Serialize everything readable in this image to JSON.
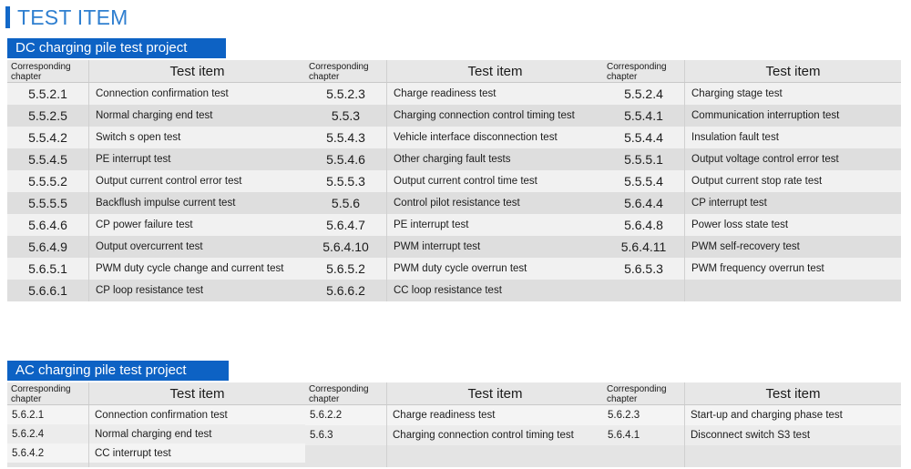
{
  "page": {
    "title": "TEST ITEM",
    "accent_color": "#1268c8",
    "title_color": "#2f7fd0",
    "banner_color": "#0d62c4"
  },
  "headers": {
    "chapter": "Corresponding chapter",
    "chapter_line1": "Corresponding",
    "chapter_line2": "chapter",
    "item": "Test item"
  },
  "dc_section": {
    "banner": "DC charging pile test project",
    "groups": [
      {
        "rows": [
          {
            "chapter": "5.5.2.1",
            "item": "Connection confirmation test"
          },
          {
            "chapter": "5.5.2.5",
            "item": "Normal charging end test"
          },
          {
            "chapter": "5.5.4.2",
            "item": "Switch s open test"
          },
          {
            "chapter": "5.5.4.5",
            "item": "PE interrupt test"
          },
          {
            "chapter": "5.5.5.2",
            "item": "Output current control error test"
          },
          {
            "chapter": "5.5.5.5",
            "item": "Backflush impulse current test"
          },
          {
            "chapter": "5.6.4.6",
            "item": "CP power failure test"
          },
          {
            "chapter": "5.6.4.9",
            "item": "Output overcurrent test"
          },
          {
            "chapter": "5.6.5.1",
            "item": "PWM duty cycle change and current test"
          },
          {
            "chapter": "5.6.6.1",
            "item": "CP loop resistance test"
          }
        ]
      },
      {
        "rows": [
          {
            "chapter": "5.5.2.3",
            "item": "Charge readiness test"
          },
          {
            "chapter": "5.5.3",
            "item": "Charging connection control timing test"
          },
          {
            "chapter": "5.5.4.3",
            "item": "Vehicle interface disconnection test"
          },
          {
            "chapter": "5.5.4.6",
            "item": "Other charging fault tests"
          },
          {
            "chapter": "5.5.5.3",
            "item": "Output current control time test"
          },
          {
            "chapter": "5.5.6",
            "item": "Control pilot resistance test"
          },
          {
            "chapter": "5.6.4.7",
            "item": "PE interrupt test"
          },
          {
            "chapter": "5.6.4.10",
            "item": "PWM interrupt test"
          },
          {
            "chapter": "5.6.5.2",
            "item": "PWM duty cycle overrun test"
          },
          {
            "chapter": "5.6.6.2",
            "item": "CC loop resistance test"
          }
        ]
      },
      {
        "rows": [
          {
            "chapter": "5.5.2.4",
            "item": "Charging stage test"
          },
          {
            "chapter": "5.5.4.1",
            "item": "Communication interruption test"
          },
          {
            "chapter": "5.5.4.4",
            "item": "Insulation fault test"
          },
          {
            "chapter": "5.5.5.1",
            "item": "Output voltage control error test"
          },
          {
            "chapter": "5.5.5.4",
            "item": "Output current stop rate test"
          },
          {
            "chapter": "5.6.4.4",
            "item": "CP interrupt test"
          },
          {
            "chapter": "5.6.4.8",
            "item": "Power loss state test"
          },
          {
            "chapter": "5.6.4.11",
            "item": "PWM self-recovery test"
          },
          {
            "chapter": "5.6.5.3",
            "item": "PWM frequency overrun test"
          },
          {
            "chapter": "",
            "item": ""
          }
        ]
      }
    ]
  },
  "ac_section": {
    "banner": "AC charging pile test project",
    "groups": [
      {
        "rows": [
          {
            "chapter": "5.6.2.1",
            "item": "Connection confirmation test"
          },
          {
            "chapter": "5.6.2.4",
            "item": "Normal charging end test"
          },
          {
            "chapter": "5.6.4.2",
            "item": "CC interrupt test"
          }
        ]
      },
      {
        "rows": [
          {
            "chapter": "5.6.2.2",
            "item": "Charge readiness test"
          },
          {
            "chapter": "5.6.3",
            "item": "Charging connection control timing test"
          }
        ]
      },
      {
        "rows": [
          {
            "chapter": "5.6.2.3",
            "item": "Start-up and charging phase test"
          },
          {
            "chapter": "5.6.4.1",
            "item": "Disconnect switch S3 test"
          }
        ]
      }
    ]
  }
}
